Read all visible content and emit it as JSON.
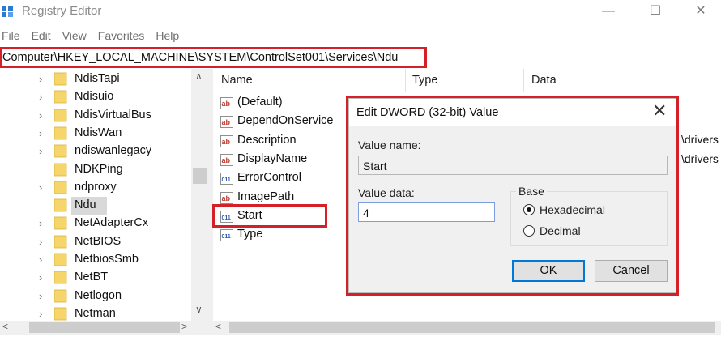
{
  "window": {
    "title": "Registry Editor",
    "min_glyph": "—",
    "max_glyph": "☐",
    "close_glyph": "✕"
  },
  "menu": [
    "File",
    "Edit",
    "View",
    "Favorites",
    "Help"
  ],
  "address": {
    "path": "Computer\\HKEY_LOCAL_MACHINE\\SYSTEM\\ControlSet001\\Services\\Ndu"
  },
  "tree": {
    "items": [
      {
        "label": "NdisTapi",
        "expandable": true
      },
      {
        "label": "Ndisuio",
        "expandable": true
      },
      {
        "label": "NdisVirtualBus",
        "expandable": true
      },
      {
        "label": "NdisWan",
        "expandable": true
      },
      {
        "label": "ndiswanlegacy",
        "expandable": true
      },
      {
        "label": "NDKPing",
        "expandable": false
      },
      {
        "label": "ndproxy",
        "expandable": true
      },
      {
        "label": "Ndu",
        "expandable": false,
        "selected": true
      },
      {
        "label": "NetAdapterCx",
        "expandable": true
      },
      {
        "label": "NetBIOS",
        "expandable": true
      },
      {
        "label": "NetbiosSmb",
        "expandable": true
      },
      {
        "label": "NetBT",
        "expandable": true
      },
      {
        "label": "Netlogon",
        "expandable": true
      },
      {
        "label": "Netman",
        "expandable": true
      }
    ],
    "expander_glyph": "›"
  },
  "values": {
    "columns": [
      "Name",
      "Type",
      "Data"
    ],
    "rows": [
      {
        "name": "(Default)",
        "icon": "string-value-icon"
      },
      {
        "name": "DependOnService",
        "icon": "string-value-icon"
      },
      {
        "name": "Description",
        "icon": "string-value-icon"
      },
      {
        "name": "DisplayName",
        "icon": "string-value-icon"
      },
      {
        "name": "ErrorControl",
        "icon": "binary-value-icon"
      },
      {
        "name": "ImagePath",
        "icon": "string-value-icon"
      },
      {
        "name": "Start",
        "icon": "binary-value-icon"
      },
      {
        "name": "Type",
        "icon": "binary-value-icon"
      }
    ],
    "data_fragments": [
      "\\drivers",
      "\\drivers"
    ]
  },
  "dialog": {
    "title": "Edit DWORD (32-bit) Value",
    "close_glyph": "✕",
    "value_name_label": "Value name:",
    "value_name": "Start",
    "value_data_label": "Value data:",
    "value_data": "4",
    "base_label": "Base",
    "base_options": [
      {
        "label": "Hexadecimal",
        "checked": true
      },
      {
        "label": "Decimal",
        "checked": false
      }
    ],
    "ok_label": "OK",
    "cancel_label": "Cancel"
  },
  "scroll_glyphs": {
    "up": "∧",
    "down": "∨",
    "left": "<",
    "right": ">"
  },
  "colors": {
    "highlight_red": "#d42027",
    "folder_yellow": "#f6d66b",
    "accent_blue": "#0078d7"
  }
}
